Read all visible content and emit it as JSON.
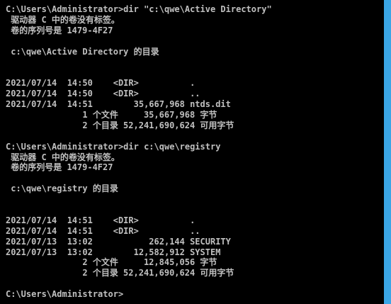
{
  "console": {
    "lines": [
      "C:\\Users\\Administrator>dir \"c:\\qwe\\Active Directory\"",
      " 驱动器 C 中的卷没有标签。",
      " 卷的序列号是 1479-4F27",
      "",
      " c:\\qwe\\Active Directory 的目录",
      "",
      "",
      "2021/07/14  14:50    <DIR>          .",
      "2021/07/14  14:50    <DIR>          ..",
      "2021/07/14  14:51        35,667,968 ntds.dit",
      "               1 个文件     35,667,968 字节",
      "               2 个目录 52,241,690,624 可用字节",
      "",
      "C:\\Users\\Administrator>dir c:\\qwe\\registry",
      " 驱动器 C 中的卷没有标签。",
      " 卷的序列号是 1479-4F27",
      "",
      " c:\\qwe\\registry 的目录",
      "",
      "",
      "2021/07/14  14:51    <DIR>          .",
      "2021/07/14  14:51    <DIR>          ..",
      "2021/07/13  13:02           262,144 SECURITY",
      "2021/07/13  13:02        12,582,912 SYSTEM",
      "               2 个文件     12,845,056 字节",
      "               2 个目录 52,241,690,624 可用字节",
      "",
      "C:\\Users\\Administrator>"
    ]
  },
  "colors": {
    "background": "#000000",
    "text": "#c0c0c0",
    "scrollbar": "#3aa6e6"
  }
}
